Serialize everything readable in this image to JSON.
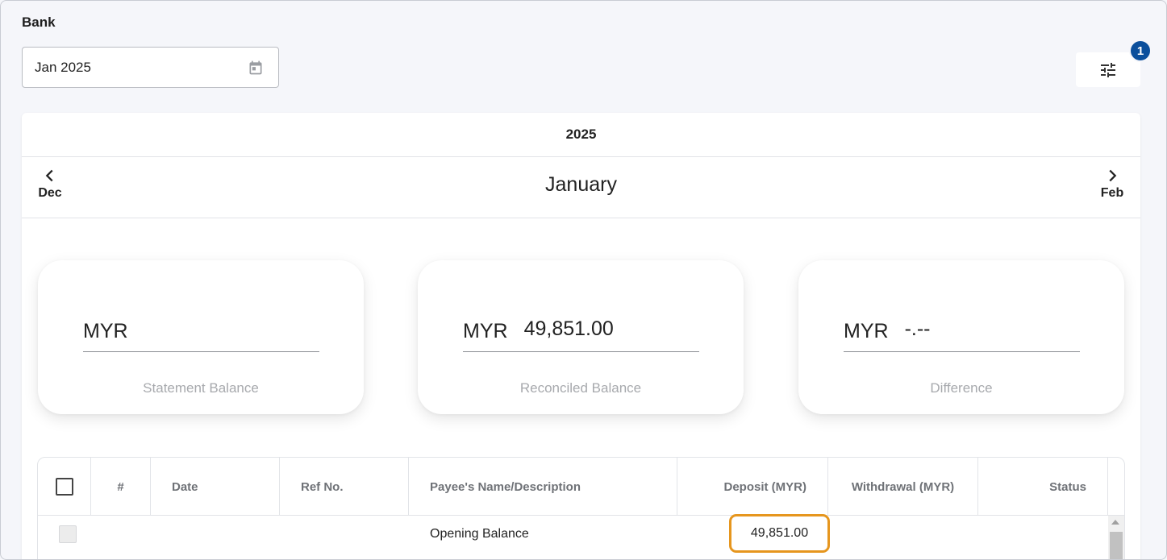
{
  "header": {
    "title": "Bank",
    "date_value": "Jan 2025",
    "filter_badge_count": "1"
  },
  "calendar": {
    "year": "2025",
    "month": "January",
    "prev_label": "Dec",
    "next_label": "Feb"
  },
  "cards": [
    {
      "currency": "MYR",
      "value": "",
      "caption": "Statement Balance"
    },
    {
      "currency": "MYR",
      "value": "49,851.00",
      "caption": "Reconciled Balance"
    },
    {
      "currency": "MYR",
      "value": "-.--",
      "caption": "Difference"
    }
  ],
  "table": {
    "columns": [
      "#",
      "Date",
      "Ref No.",
      "Payee's Name/Description",
      "Deposit (MYR)",
      "Withdrawal (MYR)",
      "Status"
    ],
    "rows": [
      {
        "number": "",
        "date": "",
        "ref": "",
        "description": "Opening Balance",
        "deposit": "49,851.00",
        "withdrawal": "",
        "status": ""
      }
    ]
  },
  "colors": {
    "accent": "#0b4f9c",
    "highlight": "#e6961e",
    "caption": "#a7a9ad"
  }
}
